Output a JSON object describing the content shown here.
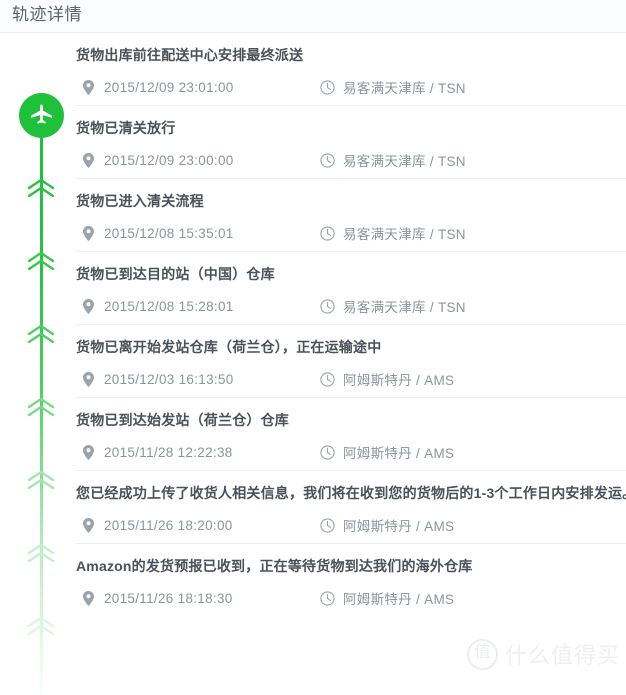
{
  "header": {
    "title": "轨迹详情"
  },
  "theme": {
    "accent_green": "#1fc03a",
    "title_color": "#5a6470",
    "event_title_color": "#4a5159",
    "meta_color": "#8a939c",
    "divider_color": "#ebedef"
  },
  "rail": {
    "top_icon": "airplane-icon",
    "step_icon": "double-chevron-up-icon",
    "chevron_count": 7
  },
  "icons": {
    "time": "location-pin-icon",
    "place": "clock-icon"
  },
  "events": [
    {
      "title": "货物出库前往配送中心安排最终派送",
      "time": "2015/12/09 23:01:00",
      "place": "易客满天津库 / TSN"
    },
    {
      "title": "货物已清关放行",
      "time": "2015/12/09 23:00:00",
      "place": "易客满天津库 / TSN"
    },
    {
      "title": "货物已进入清关流程",
      "time": "2015/12/08 15:35:01",
      "place": "易客满天津库 / TSN"
    },
    {
      "title": "货物已到达目的站（中国）仓库",
      "time": "2015/12/08 15:28:01",
      "place": "易客满天津库 / TSN"
    },
    {
      "title": "货物已离开始发站仓库（荷兰仓），正在运输途中",
      "time": "2015/12/03 16:13:50",
      "place": "阿姆斯特丹 / AMS"
    },
    {
      "title": "货物已到达始发站（荷兰仓）仓库",
      "time": "2015/11/28 12:22:38",
      "place": "阿姆斯特丹 / AMS"
    },
    {
      "title": "您已经成功上传了收货人相关信息，我们将在收到您的货物后的1-3个工作日内安排发运。",
      "time": "2015/11/26 18:20:00",
      "place": "阿姆斯特丹 / AMS"
    },
    {
      "title": "Amazon的发货预报已收到，正在等待货物到达我们的海外仓库",
      "time": "2015/11/26 18:18:30",
      "place": "阿姆斯特丹 / AMS"
    }
  ],
  "watermark": {
    "badge": "值",
    "text": "什么值得买"
  }
}
